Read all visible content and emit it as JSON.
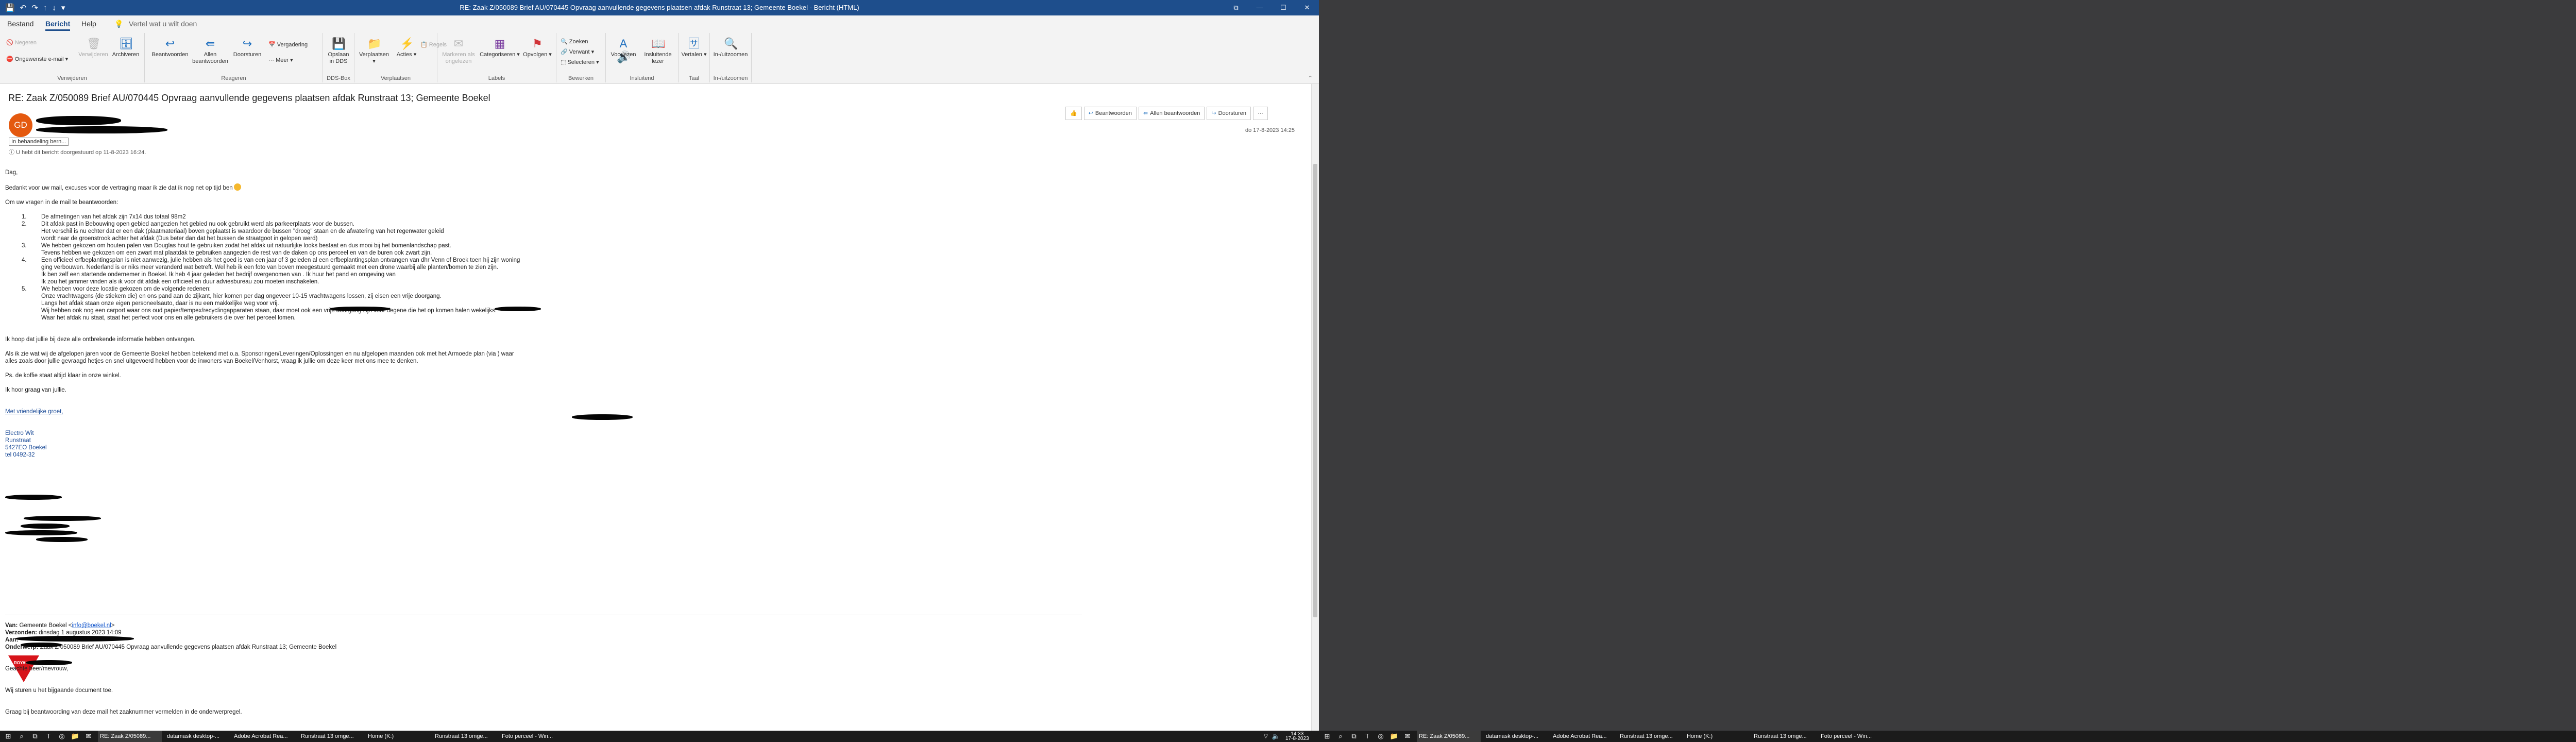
{
  "window": {
    "title": "RE: Zaak Z/050089 Brief AU/070445 Opvraag aanvullende gegevens plaatsen afdak Runstraat 13; Gemeente Boekel  -  Bericht (HTML)",
    "controls": [
      "⧉",
      "—",
      "☐",
      "✕"
    ]
  },
  "tabs": {
    "file": "Bestand",
    "message": "Bericht",
    "help": "Help",
    "tell": "Vertel wat u wilt doen"
  },
  "ribbon": {
    "delete": {
      "ignore": "Negeren",
      "junk": "Ongewenste e-mail",
      "delete_btn": "Verwijderen",
      "archive": "Archiveren",
      "label": "Verwijderen"
    },
    "respond": {
      "reply": "Beantwoorden",
      "reply_all": "Allen beantwoorden",
      "forward": "Doorsturen",
      "meeting": "Vergadering",
      "more": "Meer",
      "label": "Reageren"
    },
    "bpm": {
      "save": "Opslaan in DDS",
      "label": "DDS-Box"
    },
    "move": {
      "move": "Verplaatsen",
      "rules": "Regels",
      "actions": "Acties",
      "onenote": "OneNote",
      "label": "Verplaatsen"
    },
    "tags": {
      "unread": "Markeren als ongelezen",
      "categorize": "Categoriseren",
      "followup": "Opvolgen",
      "label": "Labels"
    },
    "editing": {
      "find": "Zoeken",
      "related": "Verwant",
      "select": "Selecteren",
      "label": "Bewerken"
    },
    "speech": {
      "read": "Voorlezen",
      "immersive": "Insluitende lezer",
      "label": "Insluitend"
    },
    "language": {
      "translate": "Vertalen",
      "label": "Taal"
    },
    "zoom": {
      "zoom": "In-/uitzoomen",
      "label": "In-/uitzoomen"
    }
  },
  "message": {
    "subject": "RE: Zaak Z/050089 Brief AU/070445 Opvraag aanvullende gegevens plaatsen afdak Runstraat 13; Gemeente Boekel",
    "avatar_initials": "GD",
    "category": "In behandeling bern...",
    "info": "U hebt dit bericht doorgestuurd op 11-8-2023 16:24.",
    "date": "do 17-8-2023 14:25",
    "actions": {
      "like": "👍",
      "reply": "Beantwoorden",
      "reply_all": "Allen beantwoorden",
      "forward": "Doorsturen",
      "more": "···"
    },
    "body": {
      "greeting": "Dag,",
      "p1": "Bedankt voor uw mail, excuses voor de vertraging maar ik zie dat ik nog net op tijd ben",
      "p2": "Om uw vragen in de mail te beantwoorden:",
      "items": [
        {
          "n": "1.",
          "lines": [
            "De afmetingen van het afdak zijn 7x14 dus totaal 98m2"
          ]
        },
        {
          "n": "2.",
          "lines": [
            "Dit afdak past in Bebouwing open gebied aangezien het gebied nu ook gebruikt werd als parkeerplaats voor de bussen.",
            "Het verschil is nu echter dat er een dak (plaatmateriaal) boven geplaatst is waardoor de bussen \"droog\" staan en de afwatering van het regenwater geleid",
            "wordt naar de groenstrook achter het afdak (Dus beter dan dat het bussen de straatgoot in gelopen werd)"
          ]
        },
        {
          "n": "3.",
          "lines": [
            "We hebben gekozen om houten palen van Douglas hout te gebruiken zodat het afdak uit natuurlijke looks bestaat en dus mooi bij het bomenlandschap past.",
            "Tevens hebben we gekozen om een zwart mat plaatdak te gebruiken aangezien de rest van de daken op ons perceel en van de buren ook zwart zijn."
          ]
        },
        {
          "n": "4.",
          "lines": [
            "Een officieel erfbeplantingsplan is niet aanwezig, julie hebben als het goed is van een jaar of 3 geleden al een erfbeplantingsplan ontvangen van dhr Venn of Broek toen hij zijn woning",
            "ging verbouwen. Nederland is er niks meer veranderd wat betreft. Wel heb ik een foto van boven meegestuurd gemaakt met een drone waarbij alle planten/bomen te zien zijn.",
            "Ik ben zelf een startende ondernemer in Boekel. Ik heb 4 jaar geleden het bedrijf overgenomen van                    . Ik huur het pand en omgeving van",
            "Ik zou het jammer vinden als ik voor dit afdak een officieel en duur adviesbureau zou moeten inschakelen."
          ]
        },
        {
          "n": "5.",
          "lines": [
            "We hebben voor deze locatie gekozen om de volgende redenen:",
            "Onze vrachtwagens (de stiekem die) en ons pand aan de zijkant, hier komen per dag ongeveer 10-15 vrachtwagens lossen, zij eisen een vrije doorgang.",
            "Langs het afdak staan onze eigen personeelsauto, daar is nu een makkelijke weg voor vrij.",
            "Wij hebben ook nog een carport waar ons oud papier/tempex/recyclingapparaten staan, daar moet ook een vrije doorgang zijn voor degene die het op komen halen wekelijks.",
            "Waar het afdak nu staat, staat het perfect voor ons en alle gebruikers die over het perceel lomen."
          ]
        }
      ],
      "p3": "Ik hoop dat jullie bij deze alle ontbrekende informatie hebben ontvangen.",
      "p4a": "Als ik zie wat wij de afgelopen jaren voor de Gemeente Boekel hebben betekend met o.a. Sponsoringen/Leveringen/Oplossingen en nu afgelopen maanden ook met het Armoede plan (via                        ) waar",
      "p4b": "alles zoals door jullie gevraagd hetjes en snel uitgevoerd hebben voor de inwoners van Boekel/Venhorst, vraag ik jullie om deze keer met ons mee te denken.",
      "p5": "Ps. de koffie staat altijd klaar in onze winkel.",
      "p6": "Ik hoor graag van jullie.",
      "sig_greeting": "Met vriendelijke groet,",
      "sig_company": "Electro Wit",
      "sig_street": "Runstraat",
      "sig_city": "5427EO Boekel",
      "sig_tel": "tel 0492-32",
      "logo_text": "ROYAL"
    },
    "quoted": {
      "from_label": "Van:",
      "from_value": "Gemeente Boekel <",
      "from_email": "info@boekel.nl",
      "from_end": ">",
      "sent_label": "Verzonden:",
      "sent_value": "dinsdag 1 augustus 2023 14:09",
      "to_label": "Aan:",
      "subject_label": "Onderwerp:",
      "subject_value": "Zaak Z/050089 Brief AU/070445 Opvraag aanvullende gegevens plaatsen afdak Runstraat 13; Gemeente Boekel",
      "salutation": "Geachte heer/mevrouw,",
      "l1": "Wij sturen u het bijgaande document toe.",
      "l2": "Graag bij beantwoording van deze mail het zaaknummer vermelden in de onderwerpregel."
    }
  },
  "taskbar": {
    "apps": [
      "RE: Zaak Z/05089...",
      "datamask desktop-...",
      "Adobe Acrobat Rea...",
      "Runstraat 13 omge...",
      "Home (K:)",
      "Runstraat 13 omge...",
      "Foto perceel - Win..."
    ],
    "time": "14:33",
    "date": "17-8-2023",
    "apps2": [
      "RE: Zaak Z/05089...",
      "datamask desktop-...",
      "Adobe Acrobat Rea...",
      "Runstraat 13 omge...",
      "Home (K:)",
      "Runstraat 13 omge...",
      "Foto perceel - Win..."
    ]
  },
  "colors": {
    "titlebar": "#1e4e8c",
    "accent": "#1e6fbf",
    "avatar": "#e4590f",
    "logo": "#d7141a",
    "signature": "#1f4e99"
  }
}
